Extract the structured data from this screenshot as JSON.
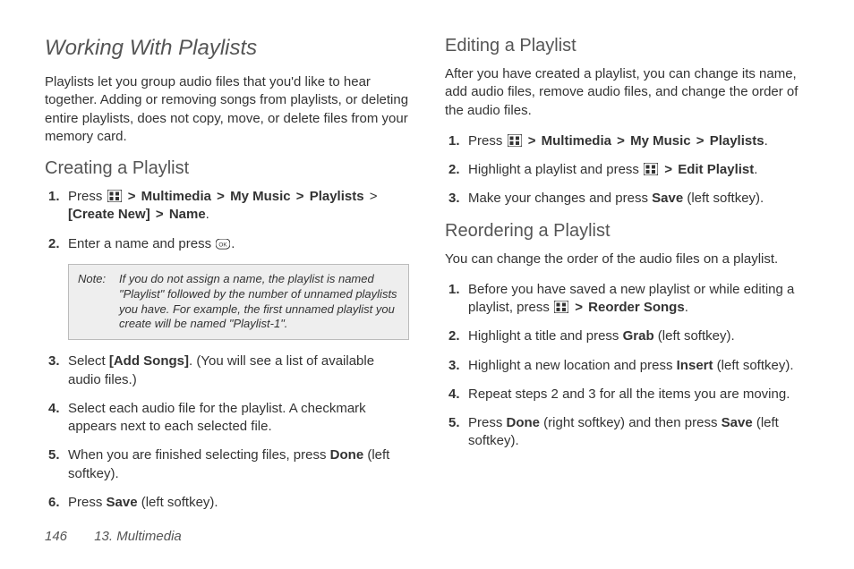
{
  "page": {
    "number": "146",
    "section": "13. Multimedia"
  },
  "title": "Working With Playlists",
  "intro": "Playlists let you group audio files that you'd like to hear together. Adding or removing songs from playlists, or deleting entire playlists, does not copy, move, or delete files from your memory card.",
  "creating": {
    "heading": "Creating a Playlist",
    "step1_prefix": "Press ",
    "step1_seq": [
      "Multimedia",
      "My Music",
      "Playlists",
      "[Create New]",
      "Name"
    ],
    "step1_suffix": ".",
    "step2": "Enter a name and press ",
    "note_label": "Note:",
    "note_text": "If you do not assign a name, the playlist is named \"Playlist\" followed by the number of unnamed playlists you have. For example, the first unnamed playlist you create will be named \"Playlist-1\".",
    "step3a": "Select ",
    "step3b": "[Add Songs]",
    "step3c": ". (You will see a list of available audio files.)",
    "step4": "Select each audio file for the playlist. A checkmark appears next to each selected file.",
    "step5a": "When you are finished selecting files, press ",
    "step5b": "Done",
    "step5c": " (left softkey).",
    "step6a": "Press ",
    "step6b": "Save",
    "step6c": " (left softkey)."
  },
  "editing": {
    "heading": "Editing a Playlist",
    "intro": "After you have created a playlist, you can change its name, add audio files, remove audio files, and change the order of the audio files.",
    "step1_prefix": "Press ",
    "step1_seq": [
      "Multimedia",
      "My Music",
      "Playlists"
    ],
    "step1_suffix": ".",
    "step2a": "Highlight a playlist and press ",
    "step2b": "Edit Playlist",
    "step2c": ".",
    "step3a": "Make your changes and press ",
    "step3b": "Save",
    "step3c": " (left softkey)."
  },
  "reordering": {
    "heading": "Reordering a Playlist",
    "intro": "You can change the order of the audio files on a playlist.",
    "step1a": "Before you have saved a new playlist or while editing a playlist, press ",
    "step1b": "Reorder Songs",
    "step1c": ".",
    "step2a": "Highlight a title and press ",
    "step2b": "Grab",
    "step2c": " (left softkey).",
    "step3a": "Highlight a new location and press ",
    "step3b": "Insert",
    "step3c": " (left softkey).",
    "step4": "Repeat steps 2 and 3 for all the items you are moving.",
    "step5a": "Press ",
    "step5b": "Done",
    "step5c": " (right softkey) and then press ",
    "step5d": "Save",
    "step5e": " (left softkey)."
  }
}
